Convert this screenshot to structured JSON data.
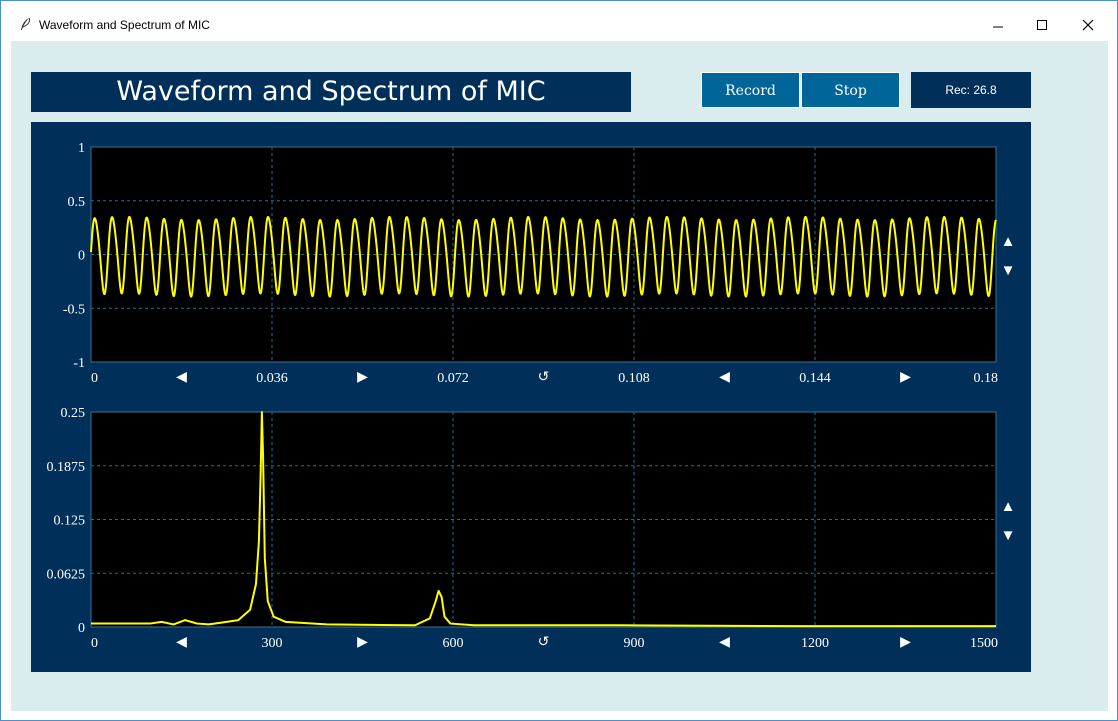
{
  "window": {
    "title": "Waveform and Spectrum of MIC",
    "icon": "feather-icon",
    "controls": [
      "minimize-icon",
      "maximize-icon",
      "close-icon"
    ]
  },
  "header": {
    "title": "Waveform and Spectrum of MIC",
    "record_label": "Record",
    "stop_label": "Stop",
    "rec_status": "Rec: 26.8"
  },
  "colors": {
    "client_bg": "#daeced",
    "panel_bg": "#00305a",
    "button_bg": "#006699",
    "plot_bg": "#000000",
    "trace": "#ffff00",
    "grid": "#1f6f8f"
  },
  "nav_glyphs": {
    "prev": "◀",
    "next": "▶",
    "reset": "↺",
    "up": "▲",
    "down": "▼"
  },
  "chart_data": [
    {
      "type": "line",
      "title": "",
      "xlabel": "",
      "ylabel": "",
      "xlim": [
        0,
        0.18
      ],
      "ylim": [
        -1,
        1
      ],
      "xticks": [
        "0",
        "0.036",
        "0.072",
        "0.108",
        "0.144",
        "0.18"
      ],
      "yticks": [
        "1",
        "0.5",
        "0",
        "-0.5",
        "-1"
      ],
      "grid": true,
      "series": [
        {
          "signal": "sine",
          "frequency_hz": 290,
          "amplitude_approx": 0.35,
          "x_range": [
            0,
            0.18
          ]
        }
      ]
    },
    {
      "type": "line",
      "title": "",
      "xlabel": "",
      "ylabel": "",
      "xlim": [
        0,
        1536
      ],
      "ylim": [
        0,
        0.25
      ],
      "xticks": [
        "0",
        "300",
        "600",
        "900",
        "1200",
        "1500"
      ],
      "yticks": [
        "0.25",
        "0.1875",
        "0.125",
        "0.0625",
        "0"
      ],
      "grid": true,
      "series": [
        {
          "x": [
            0,
            100,
            120,
            140,
            160,
            180,
            200,
            220,
            250,
            270,
            280,
            285,
            288,
            290,
            292,
            295,
            300,
            310,
            330,
            400,
            550,
            575,
            585,
            590,
            595,
            600,
            610,
            650,
            900,
            1200,
            1536
          ],
          "y": [
            0.004,
            0.004,
            0.006,
            0.003,
            0.008,
            0.004,
            0.003,
            0.005,
            0.008,
            0.02,
            0.05,
            0.1,
            0.18,
            0.25,
            0.2,
            0.08,
            0.03,
            0.012,
            0.006,
            0.003,
            0.002,
            0.01,
            0.03,
            0.042,
            0.035,
            0.012,
            0.004,
            0.002,
            0.002,
            0.001,
            0.001
          ]
        }
      ]
    }
  ]
}
